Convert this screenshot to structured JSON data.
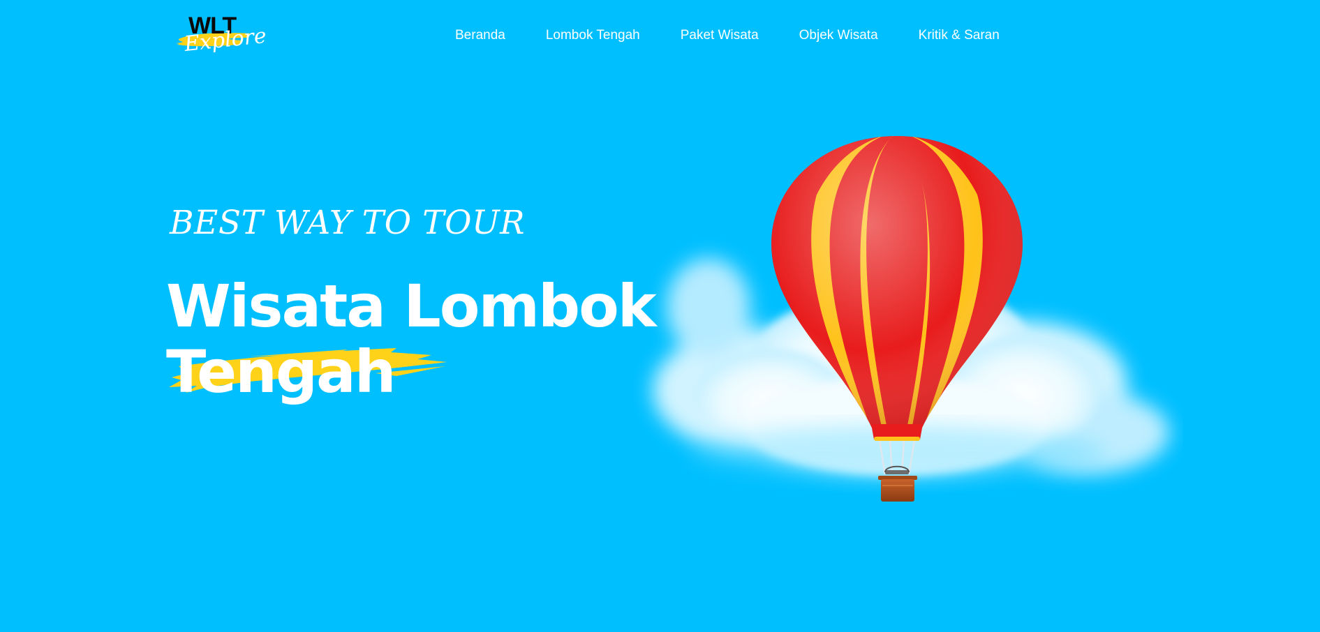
{
  "header": {
    "logo": {
      "top_text": "WLT",
      "script_text": "Explore"
    },
    "nav": [
      {
        "label": "Beranda"
      },
      {
        "label": "Lombok Tengah"
      },
      {
        "label": "Paket Wisata"
      },
      {
        "label": "Objek Wisata"
      },
      {
        "label": "Kritik & Saran"
      }
    ]
  },
  "hero": {
    "tagline": "BEST WAY TO TOUR",
    "headline_line1": "Wisata Lombok",
    "headline_line2": "Tengah"
  },
  "colors": {
    "background": "#00bfff",
    "accent_brush": "#ffd21a",
    "text": "#ffffff"
  },
  "illustration": {
    "icon": "hot-air-balloon-icon"
  }
}
